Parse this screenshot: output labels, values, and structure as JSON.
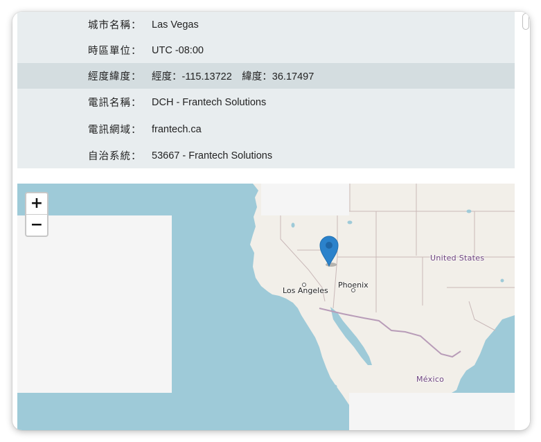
{
  "info": {
    "rows": [
      {
        "label": "城市名稱：",
        "value": "Las Vegas"
      },
      {
        "label": "時區單位：",
        "value": "UTC -08:00"
      },
      {
        "label": "經度緯度：",
        "value": "經度：-115.13722　緯度：36.17497"
      },
      {
        "label": "電訊名稱：",
        "value": "DCH - Frantech Solutions"
      },
      {
        "label": "電訊網域：",
        "value": "frantech.ca"
      },
      {
        "label": "自治系統：",
        "value": "53667 - Frantech Solutions"
      }
    ]
  },
  "map": {
    "zoom_in_label": "+",
    "zoom_out_label": "−",
    "country_label": "United States",
    "country_label_mexico": "México",
    "city_los_angeles": "Los Angeles",
    "city_phoenix": "Phoenix",
    "marker_icon": "map-pin-icon",
    "water_color": "#9ecad8",
    "land_color": "#f2efe9",
    "marker_color": "#2b82cb"
  }
}
